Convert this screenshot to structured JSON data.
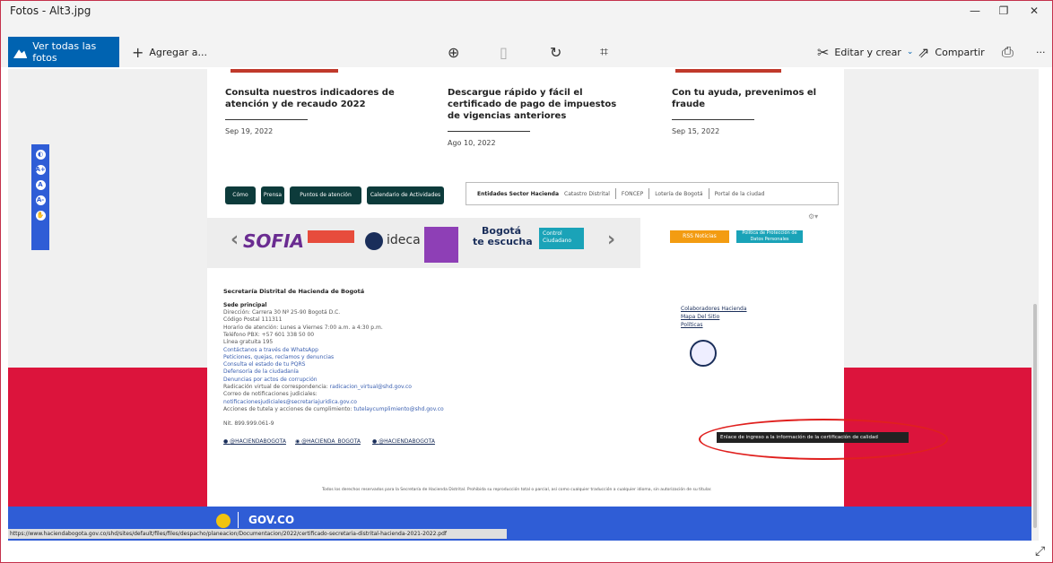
{
  "window": {
    "title": "Fotos - Alt3.jpg",
    "min_icon": "minimize-icon",
    "max_icon": "maximize-icon",
    "close_icon": "close-icon"
  },
  "toolbar": {
    "ver_todas": "Ver todas las fotos",
    "agregar": "Agregar a...",
    "editar": "Editar y crear",
    "compartir": "Compartir",
    "more": "···",
    "icons": [
      "zoom-in-icon",
      "delete-icon",
      "rotate-icon",
      "crop-icon",
      "print-icon"
    ]
  },
  "photo": {
    "news": [
      {
        "title": "Consulta nuestros indicadores de atención y de recaudo 2022",
        "date": "Sep 19, 2022"
      },
      {
        "title": "Descargue rápido y fácil el certificado de pago de impuestos de vigencias anteriores",
        "date": "Ago 10, 2022"
      },
      {
        "title": "Con tu ayuda, prevenimos el fraude",
        "date": "Sep 15, 2022"
      }
    ],
    "buttons": [
      "Cómo llegar",
      "Prensa",
      "Puntos de atención",
      "Calendario de Actividades"
    ],
    "entidades": {
      "label": "Entidades Sector Hacienda",
      "items": [
        "Catastro Distrital",
        "FONCEP",
        "Lotería de Bogotá",
        "Portal de la ciudad"
      ]
    },
    "logos": {
      "sofia": "SOFIA",
      "ideca": "ideca",
      "bogota1": "Bogotá",
      "bogota2": "te escucha",
      "control1": "Control",
      "control2": "Ciudadano"
    },
    "rss": "RSS Noticias",
    "politica": "Política de Protección de Datos Personales",
    "footer": {
      "entity": "Secretaría Distrital de Hacienda de Bogotá",
      "sede": "Sede principal",
      "lines": [
        "Dirección: Carrera 30 Nº 25-90  Bogotá D.C.",
        "Código Postal 111311",
        "Horario de atención: Lunes a Viernes 7:00 a.m. a 4:30 p.m.",
        "Teléfono PBX: +57 601 338 50 00",
        "Línea gratuita 195"
      ],
      "links": [
        "Contáctanos a través de WhatsApp",
        "Peticiones, quejas, reclamos y denuncias",
        "Consulta el estado de tu PQRS",
        "Defensoría de la ciudadanía",
        "Denuncias por actos de corrupción"
      ],
      "radicacion": "Radicación virtual de correspondencia:",
      "radicacion_mail": "radicacion_virtual@shd.gov.co",
      "correo": "Correo de notificaciones judiciales:",
      "correo_mail": "notificacionesjudiciales@secretariajuridica.gov.co",
      "acciones": "Acciones de tutela y acciones de cumplimiento:",
      "acciones_mail": "tutelaycumplimiento@shd.gov.co",
      "nit": "Nit. 899.999.061-9",
      "social": [
        "@HACIENDABOGOTA",
        "@HACIENDA_BOGOTA",
        "@HACIENDABOGOTA"
      ],
      "right_links": [
        "Colaboradores Hacienda",
        "Mapa Del Sitio",
        "Políticas"
      ],
      "copyright": "Todos los derechos reservados para la Secretaría de Hacienda Distrital. Prohibida su reproducción total o parcial, así como cualquier traducción a cualquier idioma, sin autorización de su titular."
    },
    "tooltip": "Enlace de ingreso a la información de la certificación de calidad",
    "govco": "GOV.CO",
    "status_url": "https://www.haciendabogota.gov.co/shd/sites/default/files/files/despacho/planeacion/Documentacion/2022/certificado-secretaria-distrital-hacienda-2021-2022.pdf",
    "colors": {
      "red": "#dc143c",
      "blue": "#2f5dd6",
      "accent": "#0063b1"
    }
  }
}
